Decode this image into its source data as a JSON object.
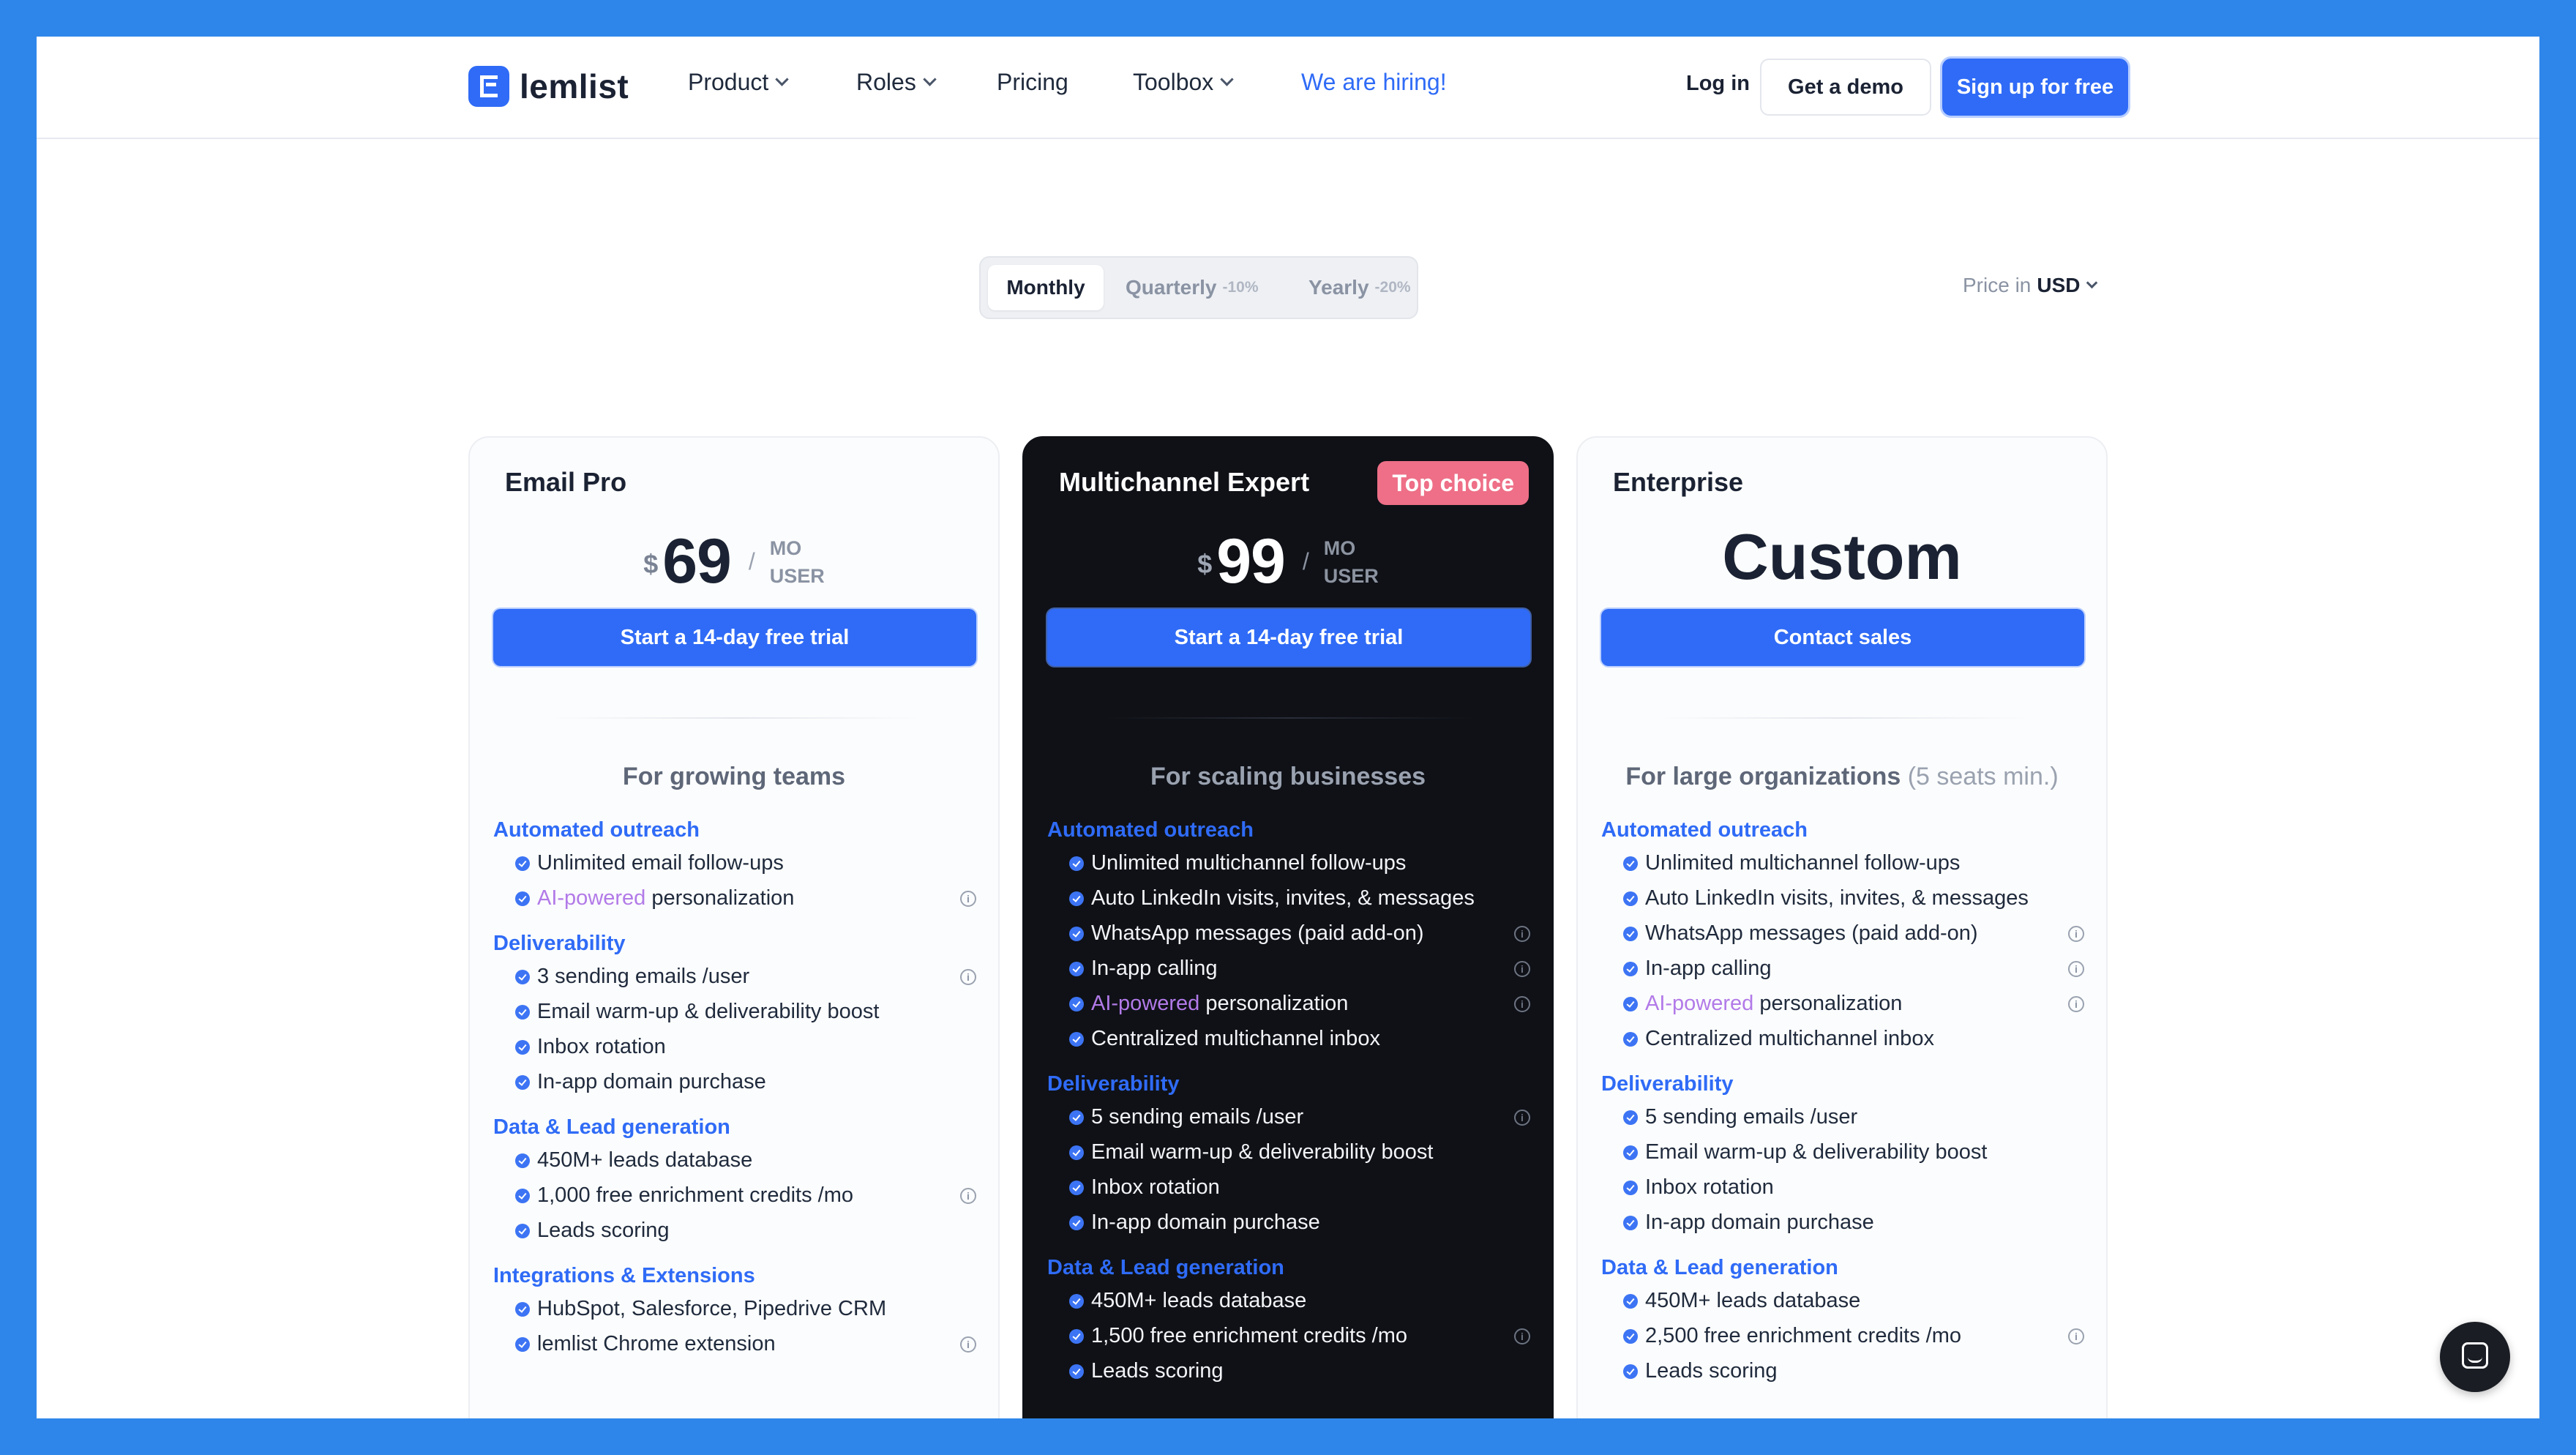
{
  "brand": {
    "name": "lemlist",
    "accent": "#2f6bf6",
    "frame_color": "#2f86ea"
  },
  "nav": {
    "items": [
      {
        "label": "Product",
        "has_dropdown": true
      },
      {
        "label": "Roles",
        "has_dropdown": true
      },
      {
        "label": "Pricing",
        "has_dropdown": false
      },
      {
        "label": "Toolbox",
        "has_dropdown": true
      },
      {
        "label": "We are hiring!",
        "has_dropdown": false
      }
    ],
    "login": "Log in",
    "demo": "Get a demo",
    "signup": "Sign up for free"
  },
  "billing": {
    "options": [
      {
        "label": "Monthly",
        "discount": "",
        "selected": true
      },
      {
        "label": "Quarterly",
        "discount": "-10%",
        "selected": false
      },
      {
        "label": "Yearly",
        "discount": "-20%",
        "selected": false
      }
    ],
    "currency_label": "Price in",
    "currency": "USD"
  },
  "plans": [
    {
      "name": "Email Pro",
      "currency_symbol": "$",
      "price": "69",
      "unit_top": "MO",
      "unit_bottom": "USER",
      "cta": "Start a 14-day free trial",
      "audience": "For growing teams",
      "sections": [
        {
          "title": "Automated outreach",
          "items": [
            {
              "text": "Unlimited email follow-ups"
            },
            {
              "ai": "AI-powered",
              "text": " personalization",
              "info": true
            }
          ]
        },
        {
          "title": "Deliverability",
          "items": [
            {
              "text": "3 sending emails /user",
              "info": true
            },
            {
              "text": "Email warm-up & deliverability boost"
            },
            {
              "text": "Inbox rotation"
            },
            {
              "text": "In-app domain purchase"
            }
          ]
        },
        {
          "title": "Data & Lead generation",
          "items": [
            {
              "text": "450M+ leads database"
            },
            {
              "text": "1,000 free enrichment credits /mo",
              "info": true
            },
            {
              "text": "Leads scoring"
            }
          ]
        },
        {
          "title": "Integrations & Extensions",
          "items": [
            {
              "text": "HubSpot, Salesforce, Pipedrive CRM"
            },
            {
              "text": "lemlist Chrome extension",
              "info": true
            }
          ]
        }
      ]
    },
    {
      "name": "Multichannel Expert",
      "badge": "Top choice",
      "currency_symbol": "$",
      "price": "99",
      "unit_top": "MO",
      "unit_bottom": "USER",
      "cta": "Start a 14-day free trial",
      "audience": "For scaling businesses",
      "sections": [
        {
          "title": "Automated outreach",
          "items": [
            {
              "text": "Unlimited multichannel follow-ups"
            },
            {
              "text": "Auto LinkedIn visits, invites, & messages"
            },
            {
              "text": "WhatsApp messages (paid add-on)",
              "info": true
            },
            {
              "text": "In-app calling",
              "info": true
            },
            {
              "ai": "AI-powered",
              "text": " personalization",
              "info": true
            },
            {
              "text": "Centralized multichannel inbox"
            }
          ]
        },
        {
          "title": "Deliverability",
          "items": [
            {
              "text": "5 sending emails /user",
              "info": true
            },
            {
              "text": "Email warm-up & deliverability boost"
            },
            {
              "text": "Inbox rotation"
            },
            {
              "text": "In-app domain purchase"
            }
          ]
        },
        {
          "title": "Data & Lead generation",
          "items": [
            {
              "text": "450M+ leads database"
            },
            {
              "text": "1,500 free enrichment credits /mo",
              "info": true
            },
            {
              "text": "Leads scoring"
            }
          ]
        }
      ]
    },
    {
      "name": "Enterprise",
      "price_text": "Custom",
      "cta": "Contact sales",
      "audience": "For large organizations",
      "audience_note": "(5 seats min.)",
      "sections": [
        {
          "title": "Automated outreach",
          "items": [
            {
              "text": "Unlimited multichannel follow-ups"
            },
            {
              "text": "Auto LinkedIn visits, invites, & messages"
            },
            {
              "text": "WhatsApp messages (paid add-on)",
              "info": true
            },
            {
              "text": "In-app calling",
              "info": true
            },
            {
              "ai": "AI-powered",
              "text": " personalization",
              "info": true
            },
            {
              "text": "Centralized multichannel inbox"
            }
          ]
        },
        {
          "title": "Deliverability",
          "items": [
            {
              "text": "5 sending emails /user"
            },
            {
              "text": "Email warm-up & deliverability boost"
            },
            {
              "text": "Inbox rotation"
            },
            {
              "text": "In-app domain purchase"
            }
          ]
        },
        {
          "title": "Data & Lead generation",
          "items": [
            {
              "text": "450M+ leads database"
            },
            {
              "text": "2,500 free enrichment credits /mo",
              "info": true
            },
            {
              "text": "Leads scoring"
            }
          ]
        }
      ]
    }
  ],
  "icons": {
    "check": "check-circle-icon",
    "info": "info-icon",
    "chat": "chat-bubble-icon"
  }
}
